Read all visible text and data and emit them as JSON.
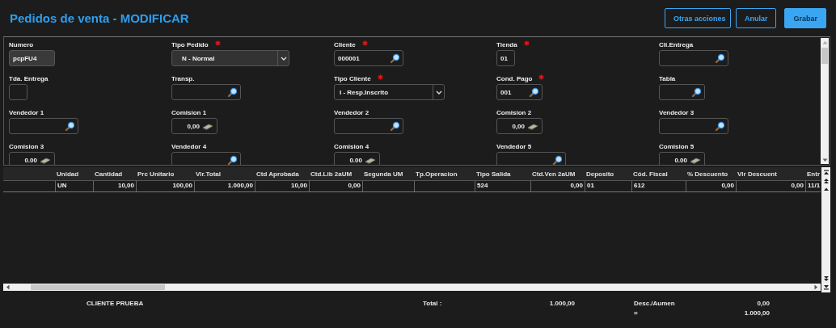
{
  "header": {
    "title": "Pedidos de venta - MODIFICAR",
    "buttons": [
      {
        "label": "Otras acciones",
        "kind": "menu"
      },
      {
        "label": "Anular",
        "kind": "outline"
      },
      {
        "label": "Grabar",
        "kind": "primary"
      }
    ]
  },
  "form": {
    "fields": [
      {
        "label": "Numero",
        "required": false,
        "kind": "readonly",
        "value": "pcpFU4"
      },
      {
        "label": "Tipo Pedido",
        "required": true,
        "kind": "select",
        "value": "N - Normal"
      },
      {
        "label": "Cliente",
        "required": true,
        "kind": "lookup",
        "value": "000001"
      },
      {
        "label": "Tienda",
        "required": true,
        "kind": "tiny",
        "value": "01"
      },
      {
        "label": "Cli.Entrega",
        "required": false,
        "kind": "lookup"
      },
      {
        "label": "Tda. Entrega",
        "required": false,
        "kind": "tiny"
      },
      {
        "label": "Transp.",
        "required": false,
        "kind": "lookup"
      },
      {
        "label": "Tipo Cliente",
        "required": true,
        "kind": "select",
        "value": "I - Resp.Inscrito"
      },
      {
        "label": "Cond. Pago",
        "required": true,
        "kind": "short-lookup",
        "value": "001"
      },
      {
        "label": "Tabla",
        "required": false,
        "kind": "short-lookup"
      },
      {
        "label": "Vendedor 1",
        "required": false,
        "kind": "lookup"
      },
      {
        "label": "Comision 1",
        "required": false,
        "kind": "money",
        "value": "0,00"
      },
      {
        "label": "Vendedor 2",
        "required": false,
        "kind": "lookup"
      },
      {
        "label": "Comision 2",
        "required": false,
        "kind": "money",
        "value": "0,00"
      },
      {
        "label": "Vendedor 3",
        "required": false,
        "kind": "lookup"
      },
      {
        "label": "Comision 3",
        "required": false,
        "kind": "money",
        "value": "0.00"
      },
      {
        "label": "Vendedor 4",
        "required": false,
        "kind": "lookup"
      },
      {
        "label": "Comision 4",
        "required": false,
        "kind": "money",
        "value": "0.00"
      },
      {
        "label": "Vendedor 5",
        "required": false,
        "kind": "lookup"
      },
      {
        "label": "Comision 5",
        "required": false,
        "kind": "money",
        "value": "0.00"
      }
    ]
  },
  "table": {
    "columns": [
      {
        "label": "Unidad",
        "kind": "text"
      },
      {
        "label": "Cantidad",
        "kind": "number"
      },
      {
        "label": "Prc Unitario",
        "kind": "number"
      },
      {
        "label": "Vlr.Total",
        "kind": "number"
      },
      {
        "label": "Ctd Aprobada",
        "kind": "number"
      },
      {
        "label": "Ctd.Lib 2aUM",
        "kind": "number"
      },
      {
        "label": "Segunda UM",
        "kind": "text"
      },
      {
        "label": "Tp.Operacion",
        "kind": "text"
      },
      {
        "label": "Tipo Salida",
        "kind": "text"
      },
      {
        "label": "Ctd.Ven 2aUM",
        "kind": "number"
      },
      {
        "label": "Deposito",
        "kind": "text"
      },
      {
        "label": "Cód. Fiscal",
        "kind": "text"
      },
      {
        "label": "% Descuento",
        "kind": "number"
      },
      {
        "label": "Vlr Descuent",
        "kind": "number"
      },
      {
        "label": "Entr",
        "kind": "text"
      }
    ],
    "rows": [
      [
        "UN",
        "10,00",
        "100,00",
        "1.000,00",
        "10,00",
        "0,00",
        "",
        "",
        "524",
        "0,00",
        "01",
        "612",
        "0,00",
        "0,00",
        "11/1"
      ]
    ]
  },
  "footer": {
    "client": "CLIENTE PRUEBA",
    "total_label": "Total :",
    "total": "1.000,00",
    "discount_label": "Desc./Aumen",
    "discount": "0,00",
    "equals": "=",
    "net": "1.000,00"
  }
}
